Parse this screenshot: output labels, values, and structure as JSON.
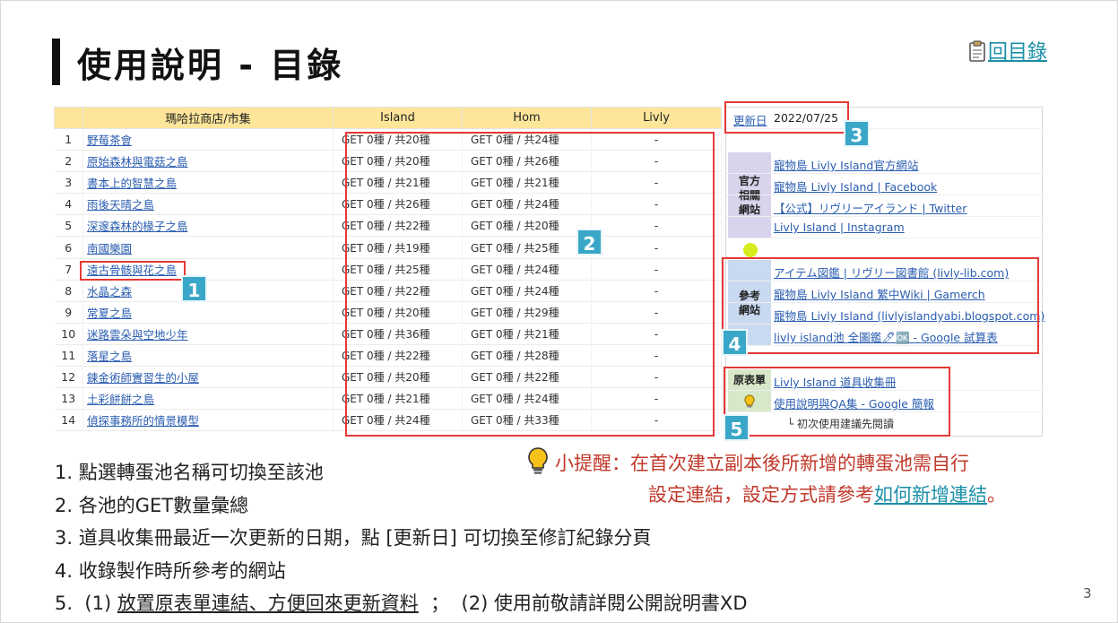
{
  "title": "使用說明 - 目錄",
  "back_link": "回目錄",
  "table": {
    "headers": [
      "瑪哈拉商店/市集",
      "Island",
      "Hom",
      "Livly"
    ],
    "rows": [
      {
        "num": "1",
        "name": "野莓茶會",
        "island": "GET 0種 / 共20種",
        "hom": "GET 0種 / 共24種",
        "livly": "-"
      },
      {
        "num": "2",
        "name": "原始森林與電菇之島",
        "island": "GET 0種 / 共20種",
        "hom": "GET 0種 / 共26種",
        "livly": "-"
      },
      {
        "num": "3",
        "name": "書本上的智慧之島",
        "island": "GET 0種 / 共21種",
        "hom": "GET 0種 / 共21種",
        "livly": "-"
      },
      {
        "num": "4",
        "name": "雨後天晴之島",
        "island": "GET 0種 / 共26種",
        "hom": "GET 0種 / 共24種",
        "livly": "-"
      },
      {
        "num": "5",
        "name": "深邃森林的椽子之島",
        "island": "GET 0種 / 共22種",
        "hom": "GET 0種 / 共20種",
        "livly": "-"
      },
      {
        "num": "6",
        "name": "南國樂園",
        "island": "GET 0種 / 共19種",
        "hom": "GET 0種 / 共25種",
        "livly": "-"
      },
      {
        "num": "7",
        "name": "遠古骨骸與花之島",
        "island": "GET 0種 / 共25種",
        "hom": "GET 0種 / 共24種",
        "livly": "-"
      },
      {
        "num": "8",
        "name": "水晶之森",
        "island": "GET 0種 / 共22種",
        "hom": "GET 0種 / 共24種",
        "livly": "-"
      },
      {
        "num": "9",
        "name": "常夏之島",
        "island": "GET 0種 / 共20種",
        "hom": "GET 0種 / 共29種",
        "livly": "-"
      },
      {
        "num": "10",
        "name": "迷路雲朵與空地少年",
        "island": "GET 0種 / 共36種",
        "hom": "GET 0種 / 共21種",
        "livly": "-"
      },
      {
        "num": "11",
        "name": "落星之島",
        "island": "GET 0種 / 共22種",
        "hom": "GET 0種 / 共28種",
        "livly": "-"
      },
      {
        "num": "12",
        "name": "鍊金術師實習生的小屋",
        "island": "GET 0種 / 共20種",
        "hom": "GET 0種 / 共22種",
        "livly": "-"
      },
      {
        "num": "13",
        "name": "土彩餅餅之島",
        "island": "GET 0種 / 共21種",
        "hom": "GET 0種 / 共24種",
        "livly": "-"
      },
      {
        "num": "14",
        "name": "偵探事務所的情景模型",
        "island": "GET 0種 / 共24種",
        "hom": "GET 0種 / 共33種",
        "livly": "-"
      }
    ]
  },
  "side": {
    "update_label": "更新日",
    "update_date": "2022/07/25",
    "official_label": "官方相關網站",
    "official_links": [
      "寵物島 Livly Island官方網站",
      "寵物島 Livly Island | Facebook",
      "【公式】リヴリーアイランド | Twitter",
      "Livly Island | Instagram"
    ],
    "ref_label": "參考網站",
    "ref_links": [
      "アイテム図鑑 | リヴリー図書館 (livly-lib.com)",
      "寵物島 Livly Island 繁中Wiki | Gamerch",
      "寵物島 Livly Island (livlyislandyabi.blogspot.com)",
      "livly island池 全圖鑑🖊🆗 - Google 試算表"
    ],
    "source_label": "原表單",
    "source_link": "Livly Island 道具收集冊",
    "qa_link": "使用說明與QA集 - Google 簡報",
    "qa_note": "└ 初次使用建議先閱讀"
  },
  "badges": [
    "1",
    "2",
    "3",
    "4",
    "5"
  ],
  "list": [
    "1.  點選轉蛋池名稱可切換至該池",
    "2.  各池的GET數量彙總",
    "3.  道具收集冊最近一次更新的日期，點 [更新日] 可切換至修訂紀錄分頁",
    "4.  收錄製作時所參考的網站"
  ],
  "item5": {
    "prefix": "5.  (1) ",
    "underlined": "放置原表單連結、方便回來更新資料",
    "suffix": "  ；  (2) 使用前敬請詳閱公開說明書XD"
  },
  "tip": {
    "line1": "小提醒：在首次建立副本後所新增的轉蛋池需自行",
    "line2_prefix": "設定連結，設定方式請參考",
    "line2_link": "如何新增連結",
    "line2_end": "。"
  },
  "page_number": "3",
  "colors": {
    "header": "#fde59a",
    "badge": "#3aa7c8",
    "highlight": "#e53935",
    "link": "#2a5db0",
    "tip": "#c0392b"
  }
}
